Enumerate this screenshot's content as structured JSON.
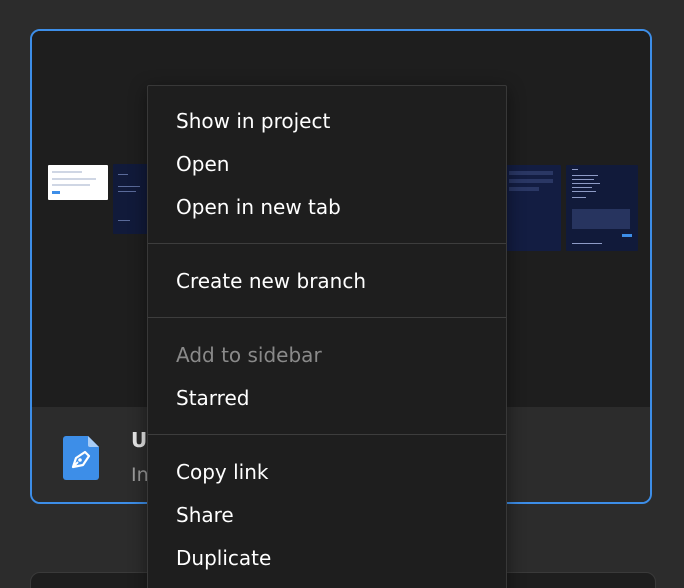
{
  "file_card": {
    "name": "U",
    "subtitle": "In",
    "icon": "pen-file-icon",
    "accent_color": "#3d8ee8"
  },
  "context_menu": {
    "groups": [
      {
        "items": [
          {
            "label": "Show in project",
            "enabled": true
          },
          {
            "label": "Open",
            "enabled": true
          },
          {
            "label": "Open in new tab",
            "enabled": true
          }
        ]
      },
      {
        "items": [
          {
            "label": "Create new branch",
            "enabled": true
          }
        ]
      },
      {
        "items": [
          {
            "label": "Add to sidebar",
            "enabled": false
          },
          {
            "label": "Starred",
            "enabled": true
          }
        ]
      },
      {
        "items": [
          {
            "label": "Copy link",
            "enabled": true
          },
          {
            "label": "Share",
            "enabled": true
          },
          {
            "label": "Duplicate",
            "enabled": true
          }
        ]
      }
    ]
  }
}
